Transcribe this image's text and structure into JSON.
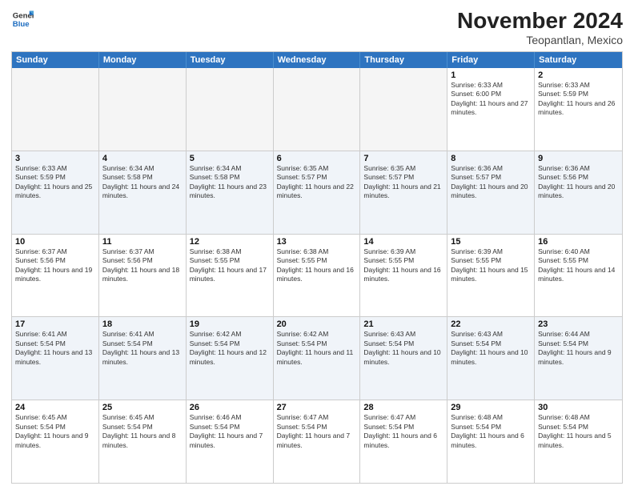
{
  "header": {
    "logo": {
      "general": "General",
      "blue": "Blue"
    },
    "title": "November 2024",
    "subtitle": "Teopantlan, Mexico"
  },
  "weekdays": [
    "Sunday",
    "Monday",
    "Tuesday",
    "Wednesday",
    "Thursday",
    "Friday",
    "Saturday"
  ],
  "weeks": [
    [
      {
        "day": "",
        "info": ""
      },
      {
        "day": "",
        "info": ""
      },
      {
        "day": "",
        "info": ""
      },
      {
        "day": "",
        "info": ""
      },
      {
        "day": "",
        "info": ""
      },
      {
        "day": "1",
        "info": "Sunrise: 6:33 AM\nSunset: 6:00 PM\nDaylight: 11 hours and 27 minutes."
      },
      {
        "day": "2",
        "info": "Sunrise: 6:33 AM\nSunset: 5:59 PM\nDaylight: 11 hours and 26 minutes."
      }
    ],
    [
      {
        "day": "3",
        "info": "Sunrise: 6:33 AM\nSunset: 5:59 PM\nDaylight: 11 hours and 25 minutes."
      },
      {
        "day": "4",
        "info": "Sunrise: 6:34 AM\nSunset: 5:58 PM\nDaylight: 11 hours and 24 minutes."
      },
      {
        "day": "5",
        "info": "Sunrise: 6:34 AM\nSunset: 5:58 PM\nDaylight: 11 hours and 23 minutes."
      },
      {
        "day": "6",
        "info": "Sunrise: 6:35 AM\nSunset: 5:57 PM\nDaylight: 11 hours and 22 minutes."
      },
      {
        "day": "7",
        "info": "Sunrise: 6:35 AM\nSunset: 5:57 PM\nDaylight: 11 hours and 21 minutes."
      },
      {
        "day": "8",
        "info": "Sunrise: 6:36 AM\nSunset: 5:57 PM\nDaylight: 11 hours and 20 minutes."
      },
      {
        "day": "9",
        "info": "Sunrise: 6:36 AM\nSunset: 5:56 PM\nDaylight: 11 hours and 20 minutes."
      }
    ],
    [
      {
        "day": "10",
        "info": "Sunrise: 6:37 AM\nSunset: 5:56 PM\nDaylight: 11 hours and 19 minutes."
      },
      {
        "day": "11",
        "info": "Sunrise: 6:37 AM\nSunset: 5:56 PM\nDaylight: 11 hours and 18 minutes."
      },
      {
        "day": "12",
        "info": "Sunrise: 6:38 AM\nSunset: 5:55 PM\nDaylight: 11 hours and 17 minutes."
      },
      {
        "day": "13",
        "info": "Sunrise: 6:38 AM\nSunset: 5:55 PM\nDaylight: 11 hours and 16 minutes."
      },
      {
        "day": "14",
        "info": "Sunrise: 6:39 AM\nSunset: 5:55 PM\nDaylight: 11 hours and 16 minutes."
      },
      {
        "day": "15",
        "info": "Sunrise: 6:39 AM\nSunset: 5:55 PM\nDaylight: 11 hours and 15 minutes."
      },
      {
        "day": "16",
        "info": "Sunrise: 6:40 AM\nSunset: 5:55 PM\nDaylight: 11 hours and 14 minutes."
      }
    ],
    [
      {
        "day": "17",
        "info": "Sunrise: 6:41 AM\nSunset: 5:54 PM\nDaylight: 11 hours and 13 minutes."
      },
      {
        "day": "18",
        "info": "Sunrise: 6:41 AM\nSunset: 5:54 PM\nDaylight: 11 hours and 13 minutes."
      },
      {
        "day": "19",
        "info": "Sunrise: 6:42 AM\nSunset: 5:54 PM\nDaylight: 11 hours and 12 minutes."
      },
      {
        "day": "20",
        "info": "Sunrise: 6:42 AM\nSunset: 5:54 PM\nDaylight: 11 hours and 11 minutes."
      },
      {
        "day": "21",
        "info": "Sunrise: 6:43 AM\nSunset: 5:54 PM\nDaylight: 11 hours and 10 minutes."
      },
      {
        "day": "22",
        "info": "Sunrise: 6:43 AM\nSunset: 5:54 PM\nDaylight: 11 hours and 10 minutes."
      },
      {
        "day": "23",
        "info": "Sunrise: 6:44 AM\nSunset: 5:54 PM\nDaylight: 11 hours and 9 minutes."
      }
    ],
    [
      {
        "day": "24",
        "info": "Sunrise: 6:45 AM\nSunset: 5:54 PM\nDaylight: 11 hours and 9 minutes."
      },
      {
        "day": "25",
        "info": "Sunrise: 6:45 AM\nSunset: 5:54 PM\nDaylight: 11 hours and 8 minutes."
      },
      {
        "day": "26",
        "info": "Sunrise: 6:46 AM\nSunset: 5:54 PM\nDaylight: 11 hours and 7 minutes."
      },
      {
        "day": "27",
        "info": "Sunrise: 6:47 AM\nSunset: 5:54 PM\nDaylight: 11 hours and 7 minutes."
      },
      {
        "day": "28",
        "info": "Sunrise: 6:47 AM\nSunset: 5:54 PM\nDaylight: 11 hours and 6 minutes."
      },
      {
        "day": "29",
        "info": "Sunrise: 6:48 AM\nSunset: 5:54 PM\nDaylight: 11 hours and 6 minutes."
      },
      {
        "day": "30",
        "info": "Sunrise: 6:48 AM\nSunset: 5:54 PM\nDaylight: 11 hours and 5 minutes."
      }
    ]
  ]
}
